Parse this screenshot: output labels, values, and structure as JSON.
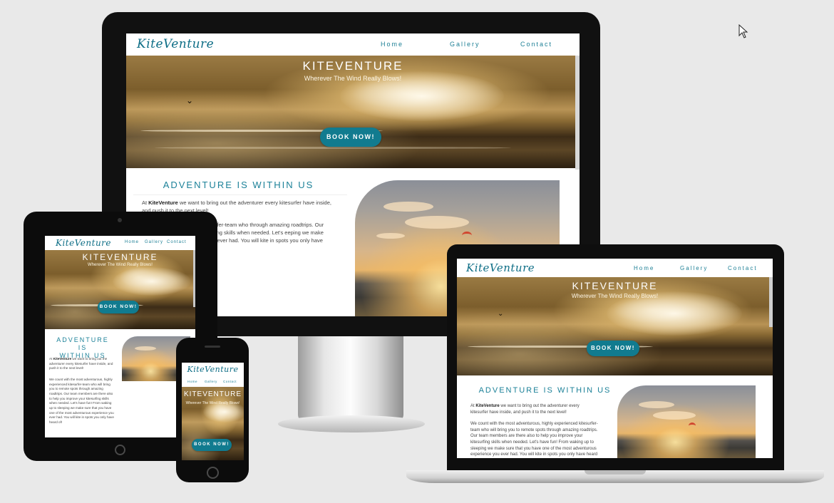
{
  "site": {
    "logo": "KiteVenture",
    "nav": [
      "Home",
      "Gallery",
      "Contact"
    ],
    "hero_title": "KITEVENTURE",
    "hero_subtitle": "Wherever The Wind Really Blows!",
    "cta": "BOOK NOW!",
    "section_title": "ADVENTURE IS WITHIN US",
    "section_title_tablet_line1": "ADVENTURE IS",
    "section_title_tablet_line2": "WITHIN US",
    "para1_prefix": "At ",
    "para1_brand": "KiteVenture",
    "para1_rest": " we want to bring out the adventurer every kitesurfer have inside, and push it to the next level!",
    "para2": "We count with the most adventurous, highly experienced kitesurfer-team who will bring you to remote spots through amazing roadtrips. Our team members are there also to help you improve your kitesurfing skills when needed. Let's have fun! From waking up to sleeping we make sure that you have one of the most adventurous experience you ever had. You will kite in spots you only have heard of!",
    "para1_monitor_suffix": "and push it to the next level!",
    "para2_monitor": "rous, highly experienced kitesurfer-team who through amazing roadtrips. Our team members ve your kitesurfing skills when needed. Let's eeping we make sure that you have one of the u ever had. You will kite in spots you only have"
  },
  "colors": {
    "accent": "#117b8f",
    "title": "#1d8299",
    "background": "#e9e9e9"
  },
  "icons": {
    "cursor": "mouse-pointer-icon"
  }
}
